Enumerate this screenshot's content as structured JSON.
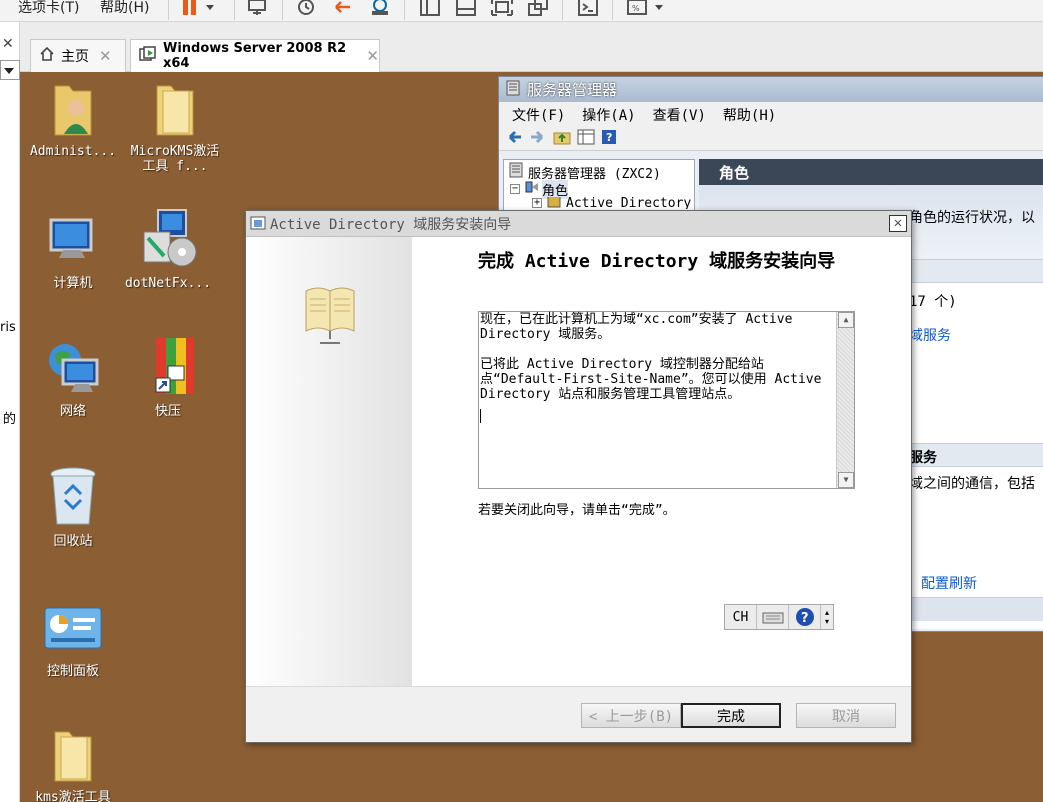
{
  "vmware": {
    "menu": {
      "tabs_label": "选项卡(T)",
      "help_label": "帮助(H)"
    },
    "icons": [
      "pause-icon",
      "send-keys-icon",
      "snapshot-icon",
      "revert-icon",
      "manage-snapshots-icon",
      "sidebar-icon",
      "single-view-icon",
      "fullscreen-icon",
      "unity-icon",
      "console-icon",
      "zoom-icon"
    ]
  },
  "tabs": [
    {
      "label": "主页",
      "icon": "home-icon"
    },
    {
      "label": "Windows Server 2008 R2 x64",
      "icon": "vm-icon"
    }
  ],
  "left_strip": {
    "fragment_1": "ris",
    "fragment_2": "的"
  },
  "desktop_icons": [
    {
      "label": "Administ...",
      "icon": "user-folder-icon"
    },
    {
      "label": "MicroKMS激活工具 f...",
      "icon": "folder-icon"
    },
    {
      "label": "计算机",
      "icon": "computer-icon"
    },
    {
      "label": "dotNetFx...",
      "icon": "installer-icon"
    },
    {
      "label": "网络",
      "icon": "network-icon"
    },
    {
      "label": "快压",
      "icon": "archive-icon"
    },
    {
      "label": "回收站",
      "icon": "recycle-bin-icon"
    },
    {
      "label": "控制面板",
      "icon": "control-panel-icon"
    },
    {
      "label": "kms激活工具",
      "icon": "folder-icon"
    }
  ],
  "server_manager": {
    "title": "服务器管理器",
    "menu": [
      "文件(F)",
      "操作(A)",
      "查看(V)",
      "帮助(H)"
    ],
    "tree": {
      "root": "服务器管理器 (ZXC2)",
      "roles": "角色",
      "ad_node": "Active Directory"
    },
    "right": {
      "header": "角色",
      "line1": "角色的运行状况，以",
      "line2": "17 个)",
      "line3": "域服务",
      "section2": "服务",
      "line4": "域之间的通信，包括",
      "refresh": "配置刷新"
    }
  },
  "wizard": {
    "title": "Active Directory 域服务安装向导",
    "heading": "完成 Active Directory 域服务安装向导",
    "summary_p1": "现在，已在此计算机上为域“xc.com”安装了 Active Directory 域服务。",
    "summary_p2": "已将此 Active Directory 域控制器分配给站点“Default-First-Site-Name”。您可以使用 Active Directory 站点和服务管理工具管理站点。",
    "footer": "若要关闭此向导，请单击“完成”。",
    "langbar": {
      "lang": "CH"
    },
    "buttons": {
      "back": "< 上一步(B)",
      "finish": "完成",
      "cancel": "取消"
    }
  },
  "colors": {
    "desktop": "#8b5e34",
    "accent_blue": "#0b5bd3"
  }
}
